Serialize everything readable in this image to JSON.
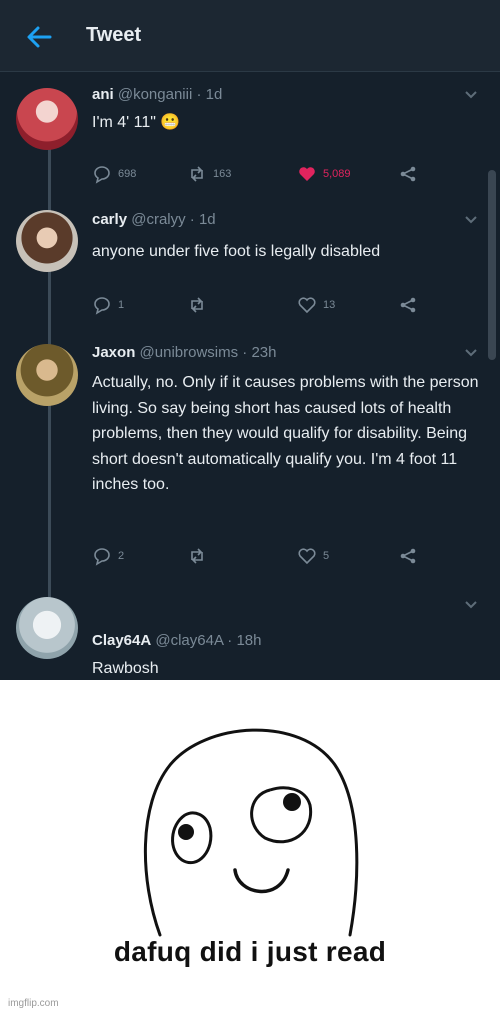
{
  "header": {
    "title": "Tweet"
  },
  "tweets": [
    {
      "name": "ani",
      "handle": "@konganiii · 1d",
      "text": "I'm 4' 11\"",
      "emoji": "😬",
      "replies": "698",
      "retweets": "163",
      "likes": "5,089",
      "liked": true
    },
    {
      "name": "carly",
      "handle": "@cralyy · 1d",
      "text": "anyone under five foot is legally disabled",
      "replies": "1",
      "retweets": "",
      "likes": "13",
      "liked": false
    },
    {
      "name": "Jaxon",
      "handle": "@unibrowsims · 23h",
      "text": "Actually, no. Only if it causes problems with the person living. So say being short has caused lots of health problems, then they would qualify for disability. Being short doesn't automatically qualify you. I'm 4 foot 11 inches too.",
      "replies": "2",
      "retweets": "",
      "likes": "5",
      "liked": false
    },
    {
      "name": "Clay64A",
      "handle": "@clay64A · 18h",
      "text": "Rawbosh"
    }
  ],
  "meme": {
    "caption": "dafuq did i just read",
    "watermark": "imgflip.com"
  },
  "colors": {
    "background": "#15202b",
    "accent": "#1da1f2",
    "like": "#e0245e",
    "muted": "#7b8a97"
  }
}
